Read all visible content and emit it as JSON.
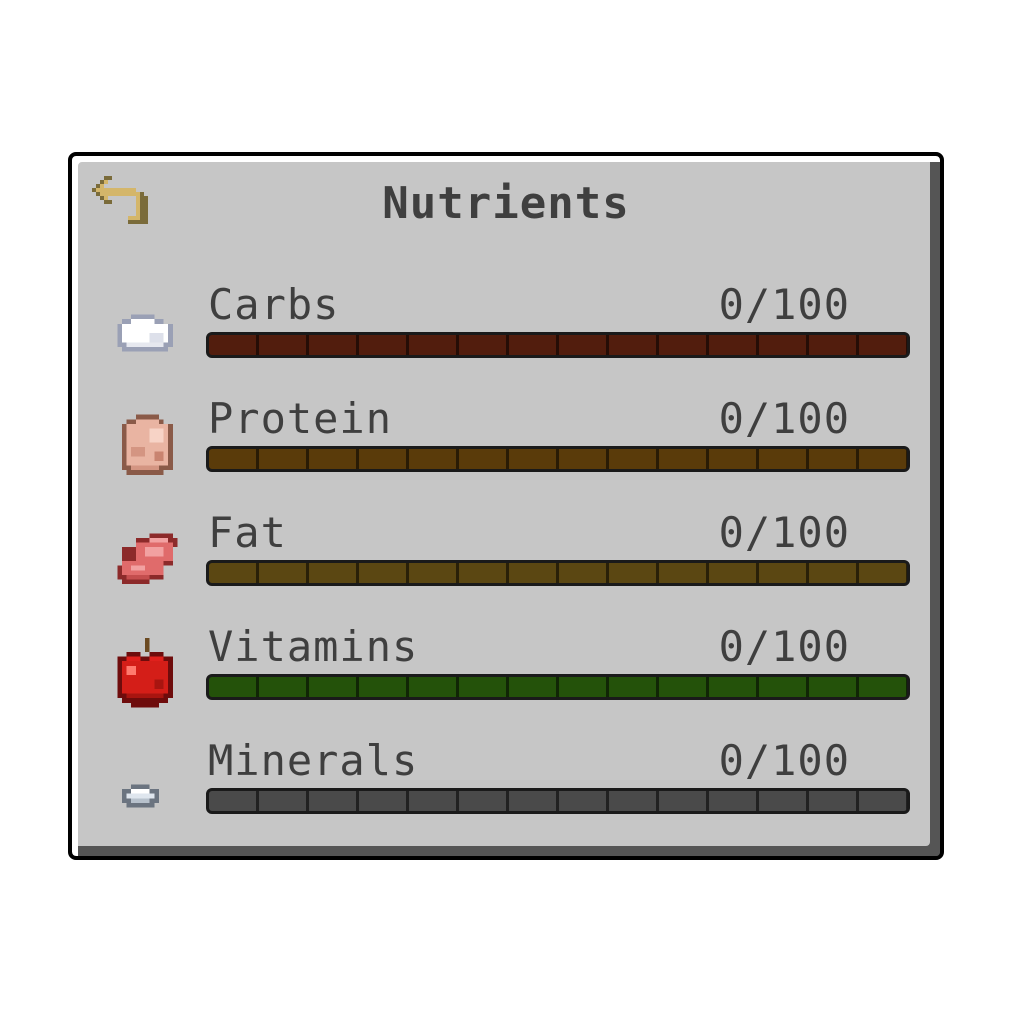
{
  "panel": {
    "title": "Nutrients",
    "back_icon": "back-arrow-icon"
  },
  "nutrients": [
    {
      "key": "carbs",
      "label": "Carbs",
      "value_text": "0/100",
      "value": 0,
      "max": 100,
      "bar_color": "#521d0d",
      "icon": "sugar-icon"
    },
    {
      "key": "protein",
      "label": "Protein",
      "value_text": "0/100",
      "value": 0,
      "max": 100,
      "bar_color": "#5a3b0a",
      "icon": "raw-chicken-icon"
    },
    {
      "key": "fat",
      "label": "Fat",
      "value_text": "0/100",
      "value": 0,
      "max": 100,
      "bar_color": "#5b4712",
      "icon": "raw-beef-icon"
    },
    {
      "key": "vitamins",
      "label": "Vitamins",
      "value_text": "0/100",
      "value": 0,
      "max": 100,
      "bar_color": "#24520a",
      "icon": "apple-icon"
    },
    {
      "key": "minerals",
      "label": "Minerals",
      "value_text": "0/100",
      "value": 0,
      "max": 100,
      "bar_color": "#4a4a4a",
      "icon": "iron-nugget-icon"
    }
  ]
}
